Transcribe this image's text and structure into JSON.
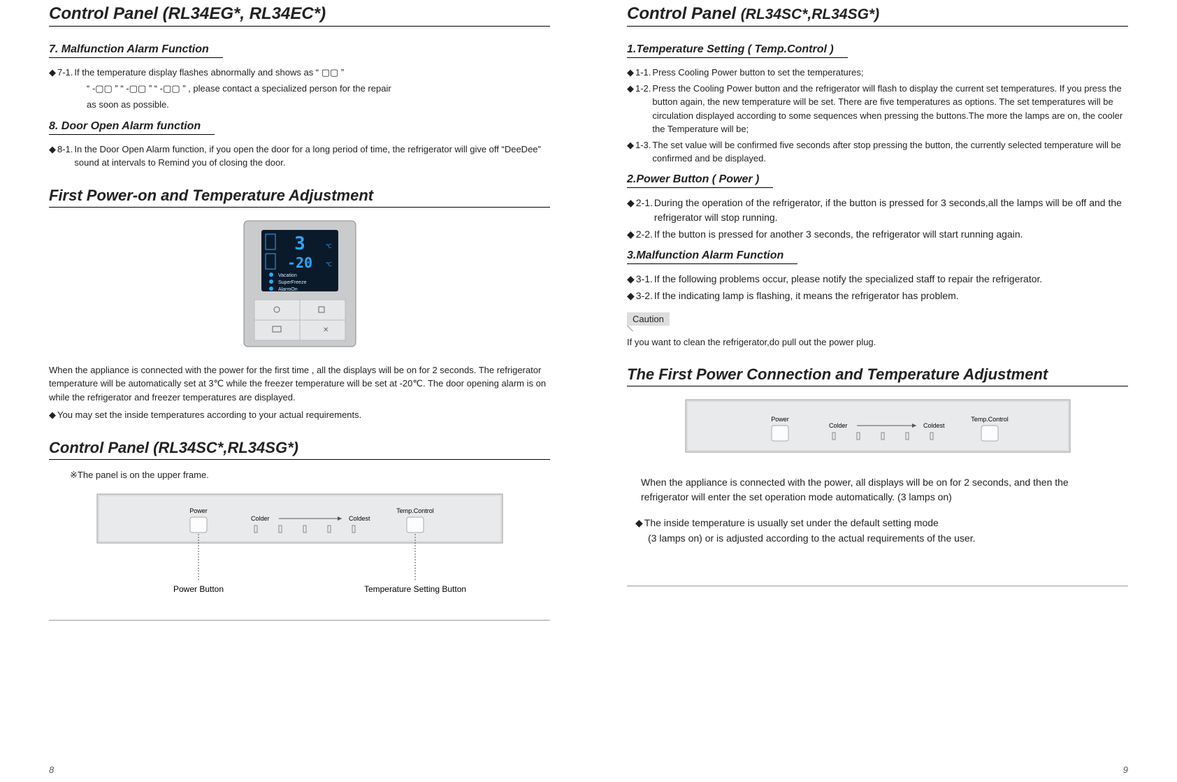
{
  "left": {
    "title": "Control Panel (RL34EG*, RL34EC*)",
    "s7": {
      "heading": "7. Malfunction Alarm Function",
      "b71_a": "7-1.",
      "b71_t": "If the temperature display flashes abnormally and shows as  “ ▢▢ ”",
      "line2": "“ -▢▢ ”   “ -▢▢ ”   “ -▢▢ ” , please contact a specialized person for the repair",
      "line3": "as soon as possible."
    },
    "s8": {
      "heading": "8.  Door Open Alarm function",
      "b81_a": "8-1.",
      "b81_t": "In the Door Open Alarm function, if you open the door for a long period of time, the refrigerator will give off “DeeDee” sound at intervals to Remind you of closing the door."
    },
    "first_power": {
      "heading": "First Power-on and Temperature Adjustment",
      "big_temp": "3",
      "small_temp": "-20",
      "deg": "℃",
      "row1": "Vacation",
      "row2": "SuperFreeze",
      "row3": "AlarmOn",
      "para": "When the appliance is connected with the power for the first time , all the displays will be on for 2 seconds. The refrigerator temperature will be automatically set at 3℃ while the freezer temperature will be set at -20℃. The door opening alarm is on while the refrigerator and freezer temperatures are displayed.",
      "bullet": "You may set the inside temperatures according to your actual requirements."
    },
    "panel2": {
      "heading": "Control Panel (RL34SC*,RL34SG*)",
      "note": "※The panel is on the upper frame.",
      "power": "Power",
      "colder": "Colder",
      "coldest": "Coldest",
      "temp": "Temp.Control",
      "label_power": "Power Button",
      "label_temp": "Temperature Setting Button"
    },
    "pagenum": "8"
  },
  "right": {
    "title_a": "Control Panel ",
    "title_b": "(RL34SC*,RL34SG*)",
    "s1": {
      "heading": "1.Temperature Setting  ( Temp.Control )",
      "b11_a": "1-1.",
      "b11_t": "Press Cooling Power button to set the  temperatures;",
      "b12_a": "1-2.",
      "b12_t": "Press the Cooling Power button and the refrigerator will flash to display the current set temperatures. If you press the button again, the new temperature  will be set. There are five temperatures as options. The set temperatures will be circulation displayed according to some sequences when pressing the buttons.The more the lamps are on, the cooler the Temperature will be;",
      "b13_a": "1-3.",
      "b13_t": "The set value will be confirmed five seconds after stop pressing the button, the currently selected temperature will be confirmed and be displayed."
    },
    "s2": {
      "heading": "2.Power Button ( Power )",
      "b21_a": "2-1.",
      "b21_t": "During the operation of the refrigerator, if the button is pressed for 3 seconds,all the lamps will be off and the refrigerator will stop running.",
      "b22_a": "2-2.",
      "b22_t": "If the button is pressed for another 3 seconds, the refrigerator will start running again."
    },
    "s3": {
      "heading": "3.Malfunction Alarm Function",
      "b31_a": "3-1.",
      "b31_t": "If the following problems occur, please notify the specialized staff to repair the refrigerator.",
      "b32_a": "3-2.",
      "b32_t": "If the indicating lamp is flashing, it means the refrigerator has problem."
    },
    "caution": "Caution",
    "caution_text": "If you want to clean the refrigerator,do pull out the power plug.",
    "first_conn": {
      "heading": "The First Power Connection and Temperature Adjustment",
      "power": "Power",
      "colder": "Colder",
      "coldest": "Coldest",
      "temp": "Temp.Control",
      "para": "When the appliance is connected with the power, all displays will be on for 2 seconds, and then the refrigerator will enter the set operation mode automatically. (3 lamps on)",
      "bullet": "The inside temperature is usually set under the  default setting mode",
      "bullet2": "(3 lamps on) or is adjusted according to the actual requirements of the user."
    },
    "pagenum": "9"
  }
}
